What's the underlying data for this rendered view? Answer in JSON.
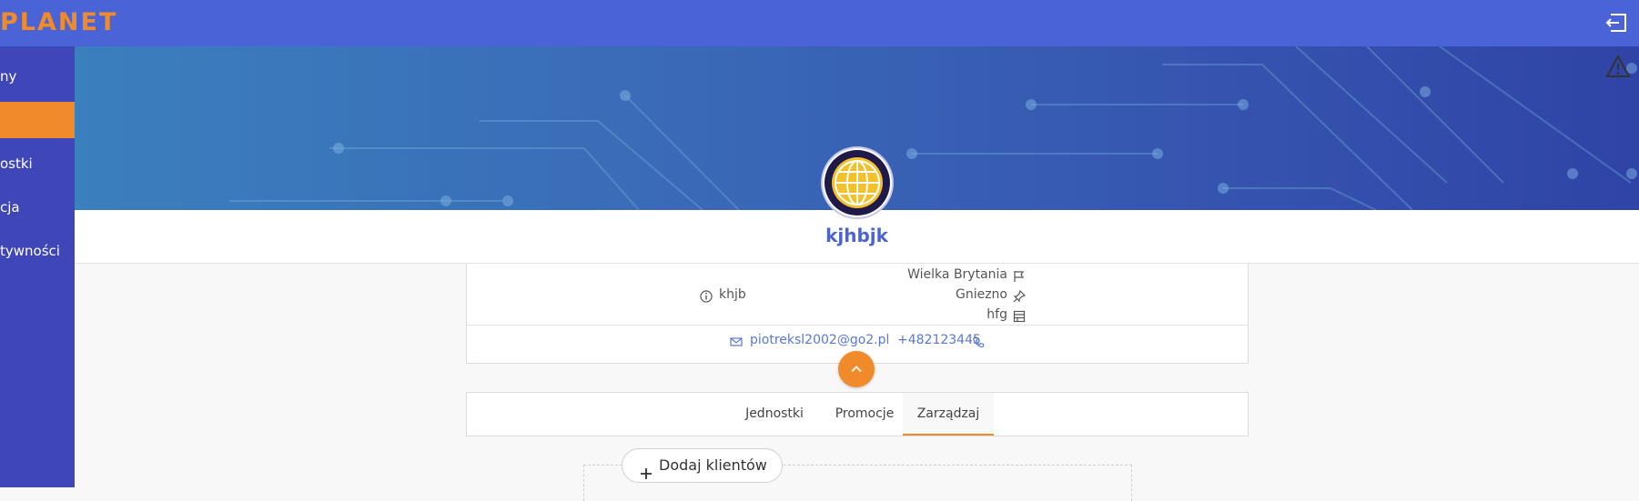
{
  "header": {
    "logo_text": "PLANET"
  },
  "sidebar": {
    "items": [
      {
        "label": "ny"
      },
      {
        "label": ""
      },
      {
        "label": "ostki"
      },
      {
        "label": "cja"
      },
      {
        "label": "tywności"
      }
    ]
  },
  "profile": {
    "name": "kjhbjk",
    "description": "khjb",
    "country": "Wielka Brytania",
    "city": "Gniezno",
    "extra": "hfg",
    "email": "piotreksl2002@go2.pl",
    "phone": "+482123445"
  },
  "tabs": [
    {
      "label": "Jednostki"
    },
    {
      "label": "Promocje"
    },
    {
      "label": "Zarządzaj"
    }
  ],
  "actions": {
    "add_clients": "Dodaj klientów"
  },
  "colors": {
    "accent": "#f08a2a",
    "primary": "#4a64d8",
    "sidebar": "#3f47b8"
  }
}
